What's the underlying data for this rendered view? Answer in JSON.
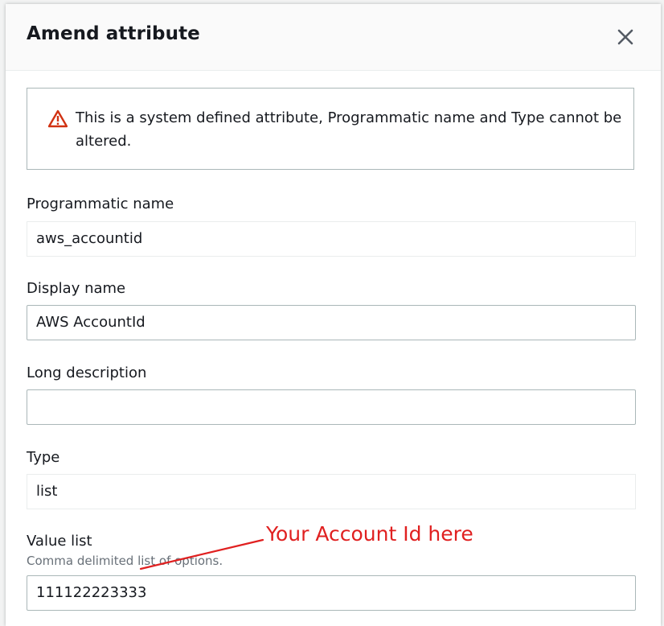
{
  "modal": {
    "title": "Amend attribute"
  },
  "alert": {
    "message": "This is a system defined attribute, Programmatic name and Type cannot be altered."
  },
  "fields": {
    "programmatic_name": {
      "label": "Programmatic name",
      "value": "aws_accountid"
    },
    "display_name": {
      "label": "Display name",
      "value": "AWS AccountId"
    },
    "long_description": {
      "label": "Long description",
      "value": ""
    },
    "type": {
      "label": "Type",
      "value": "list"
    },
    "value_list": {
      "label": "Value list",
      "description": "Comma delimited list of options.",
      "value": "111122223333"
    }
  },
  "annotation": {
    "text": "Your Account Id here",
    "color": "#e02020"
  },
  "colors": {
    "warning": "#d13212",
    "text": "#16191f",
    "muted": "#687078",
    "border": "#aab7b8"
  }
}
